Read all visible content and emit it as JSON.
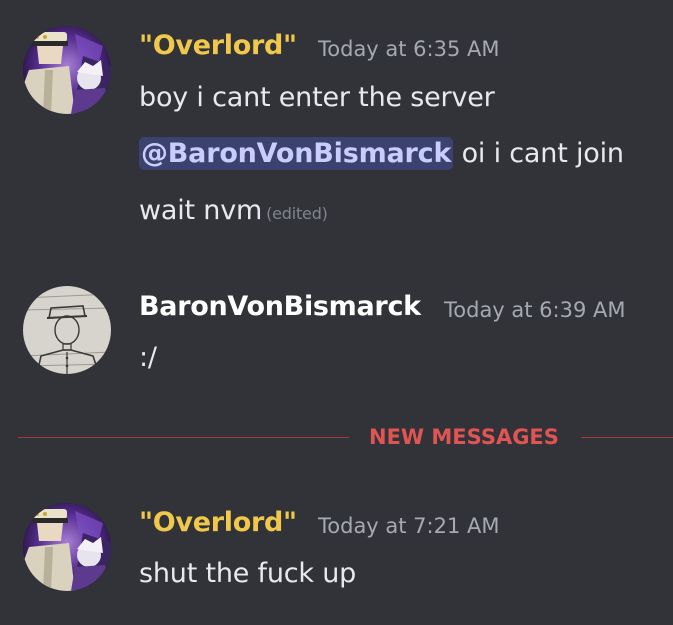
{
  "messages": [
    {
      "author": "\"Overlord\"",
      "author_color": "#f0c84b",
      "timestamp": "Today at 6:35 AM",
      "avatar_icon": "anime-character-avatar",
      "lines": [
        {
          "text": "boy i cant enter the server"
        },
        {
          "mention": "@BaronVonBismarck",
          "text": " oi i cant join"
        },
        {
          "text": "wait nvm",
          "edited": "(edited)"
        }
      ]
    },
    {
      "author": "BaronVonBismarck",
      "author_color": "#ffffff",
      "timestamp": "Today at 6:39 AM",
      "avatar_icon": "pencil-sketch-soldier-avatar",
      "lines": [
        {
          "text": ":/"
        }
      ]
    },
    {
      "author": "\"Overlord\"",
      "author_color": "#f0c84b",
      "timestamp": "Today at 7:21 AM",
      "avatar_icon": "anime-character-avatar",
      "lines": [
        {
          "text": "shut the fuck up"
        }
      ]
    }
  ],
  "divider": {
    "label": "NEW MESSAGES",
    "color": "#e05454"
  }
}
